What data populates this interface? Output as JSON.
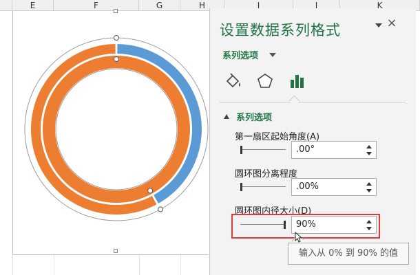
{
  "spreadsheet": {
    "columns": [
      "E",
      "F",
      "G",
      "H",
      "I",
      "J",
      "K"
    ]
  },
  "pane": {
    "title": "设置数据系列格式",
    "close_label": "×",
    "subtitle": "系列选项",
    "tabs": [
      "fill-line-icon",
      "effects-pentagon-icon",
      "series-options-bar-icon"
    ],
    "section_title": "系列选项",
    "fields": [
      {
        "label": "第一扇区起始角度(A)",
        "value": ".00°"
      },
      {
        "label": "圆环图分离程度",
        "value": ".00%"
      },
      {
        "label": "圆环图内径大小(D)",
        "value": "90%"
      }
    ],
    "tooltip": "输入从 0% 到 90% 的值"
  },
  "colors": {
    "accent_green": "#217346",
    "series_blue": "#5b9bd5",
    "series_orange": "#ed7d31",
    "highlight_red": "#e0393b"
  },
  "chart_data": {
    "type": "doughnut",
    "rings": [
      {
        "ring": "outer",
        "segments": [
          {
            "color": "#5b9bd5",
            "fraction": 0.42
          },
          {
            "color": "#ed7d31",
            "fraction": 0.58
          }
        ]
      },
      {
        "ring": "inner",
        "segments": [
          {
            "color": "#ed7d31",
            "fraction": 1.0
          }
        ]
      }
    ],
    "start_angle": 0,
    "hole_size_percent": 90
  }
}
